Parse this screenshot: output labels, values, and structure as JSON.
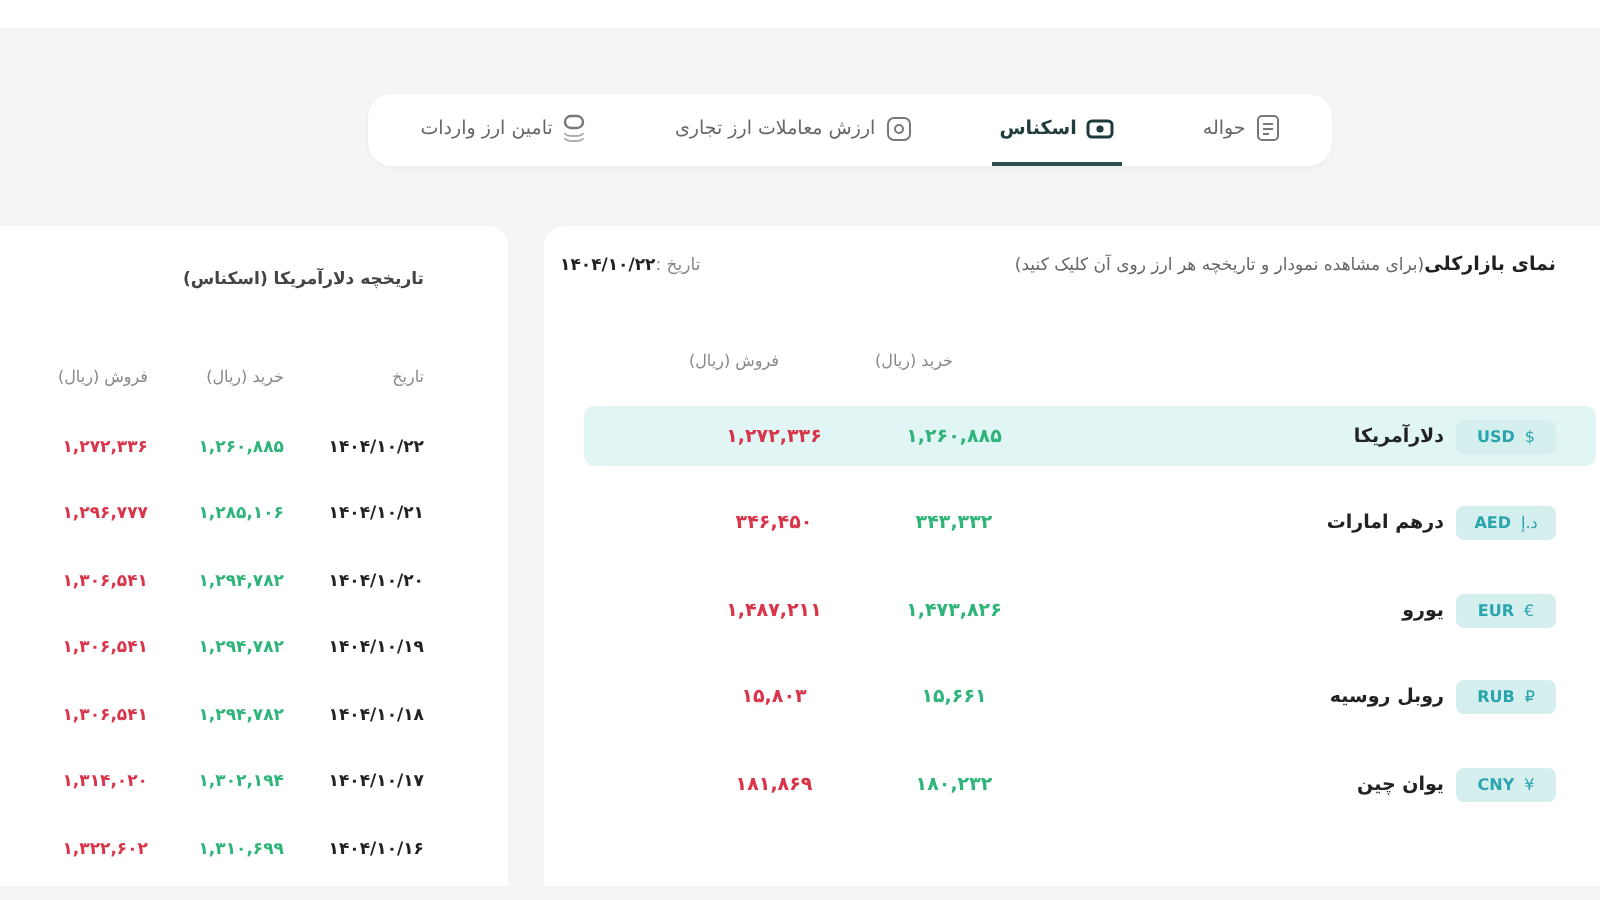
{
  "tabs": [
    {
      "label": "حواله",
      "selected": false
    },
    {
      "label": "اسکناس",
      "selected": true
    },
    {
      "label": "ارزش معاملات ارز تجاری",
      "selected": false
    },
    {
      "label": "تامین ارز واردات",
      "selected": false
    }
  ],
  "market": {
    "title": "**نمای بازارکلی**(برای مشاهده نمودار و تاریخچه هر ارز روی آن کلیک کنید)",
    "date": "تاریخ :**۱۴۰۴/۱۰/۲۲**",
    "columns": [
      "خرید (ریال)",
      "فروش (ریال)"
    ],
    "rows": [
      {
        "code": "USD",
        "symbol": "$",
        "name": "دلارآمریکا",
        "buy": "۱,۲۶۰,۸۸۵",
        "sell": "۱,۲۷۲,۳۳۶",
        "selected": true
      },
      {
        "code": "AED",
        "symbol": "د.إ",
        "name": "درهم امارات",
        "buy": "۳۴۳,۳۳۲",
        "sell": "۳۴۶,۴۵۰",
        "selected": false
      },
      {
        "code": "EUR",
        "symbol": "€",
        "name": "یورو",
        "buy": "۱,۴۷۳,۸۲۶",
        "sell": "۱,۴۸۷,۲۱۱",
        "selected": false
      },
      {
        "code": "RUB",
        "symbol": "₽",
        "name": "روبل روسیه",
        "buy": "۱۵,۶۶۱",
        "sell": "۱۵,۸۰۳",
        "selected": false
      },
      {
        "code": "CNY",
        "symbol": "¥",
        "name": "یوان چین",
        "buy": "۱۸۰,۲۳۲",
        "sell": "۱۸۱,۸۶۹",
        "selected": false
      }
    ]
  },
  "history": {
    "title": "تاریخچه دلارآمریکا (اسکناس)",
    "columns": [
      "تاریخ",
      "خرید (ریال)",
      "فروش (ریال)"
    ],
    "rows": [
      {
        "date": "۱۴۰۴/۱۰/۲۲",
        "buy": "۱,۲۶۰,۸۸۵",
        "sell": "۱,۲۷۲,۳۳۶"
      },
      {
        "date": "۱۴۰۴/۱۰/۲۱",
        "buy": "۱,۲۸۵,۱۰۶",
        "sell": "۱,۲۹۶,۷۷۷"
      },
      {
        "date": "۱۴۰۴/۱۰/۲۰",
        "buy": "۱,۲۹۴,۷۸۲",
        "sell": "۱,۳۰۶,۵۴۱"
      },
      {
        "date": "۱۴۰۴/۱۰/۱۹",
        "buy": "۱,۲۹۴,۷۸۲",
        "sell": "۱,۳۰۶,۵۴۱"
      },
      {
        "date": "۱۴۰۴/۱۰/۱۸",
        "buy": "۱,۲۹۴,۷۸۲",
        "sell": "۱,۳۰۶,۵۴۱"
      },
      {
        "date": "۱۴۰۴/۱۰/۱۷",
        "buy": "۱,۳۰۲,۱۹۴",
        "sell": "۱,۳۱۴,۰۲۰"
      },
      {
        "date": "۱۴۰۴/۱۰/۱۶",
        "buy": "۱,۳۱۰,۶۹۹",
        "sell": "۱,۳۲۲,۶۰۲"
      }
    ]
  }
}
